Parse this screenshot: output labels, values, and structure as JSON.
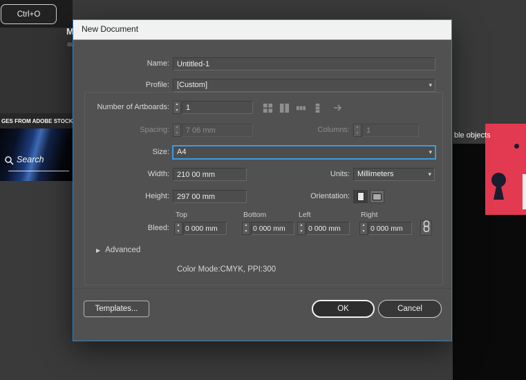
{
  "colors": {
    "accent_blue": "#2f86c6",
    "focus_blue": "#3f9bdd",
    "red_card": "#e23a50",
    "dialog_bg": "#515151"
  },
  "icons": {
    "stepper_up": "▴",
    "stepper_down": "▾",
    "chevron_down": "▾",
    "advanced_triangle": "▶"
  },
  "background": {
    "ctrl_o": "Ctrl+O",
    "heading_fragment": "M",
    "subtext_fragment": "au",
    "stock_banner": "GES FROM ADOBE STOCK",
    "search_label": "Search",
    "right_text_fragment": "ble objects"
  },
  "dialog": {
    "title": "New Document",
    "name": {
      "label": "Name:",
      "value": "Untitled-1"
    },
    "profile": {
      "label": "Profile:",
      "value": "[Custom]"
    },
    "artboards": {
      "label": "Number of Artboards:",
      "value": "1"
    },
    "spacing": {
      "label": "Spacing:",
      "value": "7 06 mm"
    },
    "columns": {
      "label": "Columns:",
      "value": "1"
    },
    "size": {
      "label": "Size:",
      "value": "A4"
    },
    "width": {
      "label": "Width:",
      "value": "210 00 mm"
    },
    "units": {
      "label": "Units:",
      "value": "Millimeters"
    },
    "height": {
      "label": "Height:",
      "value": "297 00 mm"
    },
    "orientation": {
      "label": "Orientation:"
    },
    "bleed": {
      "label": "Bleed:",
      "cols": [
        "Top",
        "Bottom",
        "Left",
        "Right"
      ],
      "values": [
        "0 000 mm",
        "0 000 mm",
        "0 000 mm",
        "0 000 mm"
      ]
    },
    "advanced_label": "Advanced",
    "color_mode": "Color Mode:CMYK, PPI:300",
    "buttons": {
      "templates": "Templates...",
      "ok": "OK",
      "cancel": "Cancel"
    }
  }
}
